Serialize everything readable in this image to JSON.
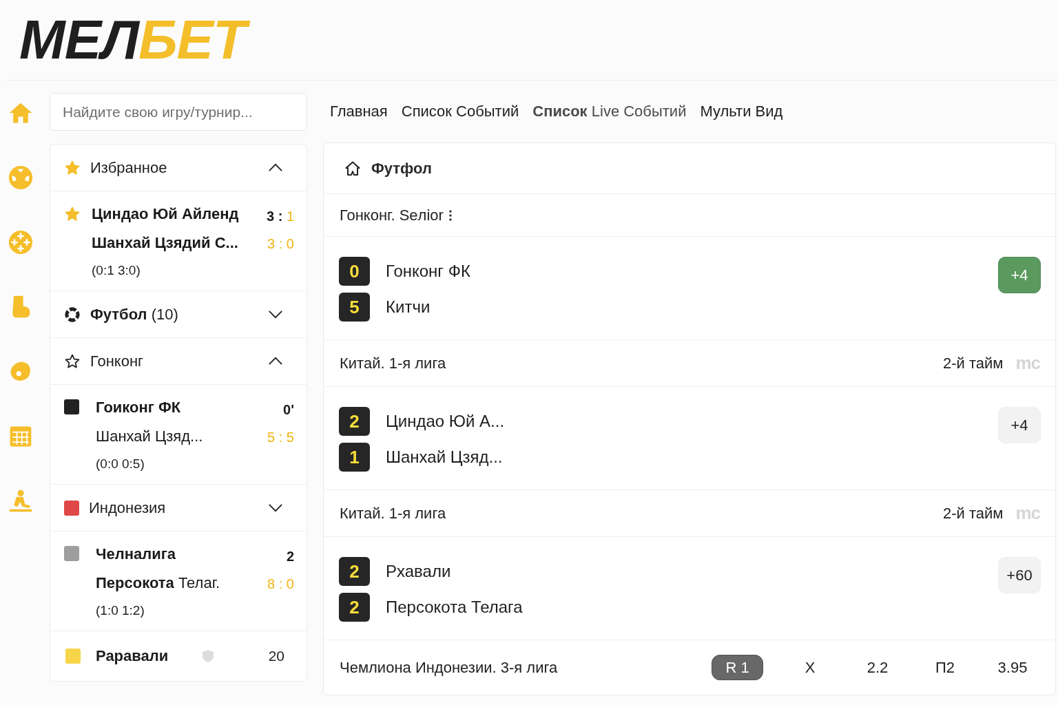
{
  "logo": {
    "dark_part": "МЕЛ",
    "accent_part": "БЕТ"
  },
  "search": {
    "placeholder": "Найдите свою игру/турнир..."
  },
  "sidebar": {
    "items": [
      {
        "kind": "section",
        "label": "Избранное",
        "favorite": true,
        "expanded": true
      },
      {
        "kind": "match",
        "favorite": true,
        "teams": [
          {
            "name": "Циндао Юй Айленд",
            "bold": true
          },
          {
            "name": "Шанхай Цзядий С...",
            "bold": true
          }
        ],
        "detail": "(0:1 3:0)",
        "score_lines": [
          [
            {
              "text": "3 :",
              "accent": false
            },
            {
              "text": "1",
              "accent": true
            }
          ],
          [
            {
              "text": "3 : 0",
              "accent": true
            }
          ]
        ]
      },
      {
        "kind": "sport",
        "label": "**Футбол** (10)",
        "expanded": false
      },
      {
        "kind": "section",
        "label": "Гонконг",
        "favorite": false,
        "expanded": true
      },
      {
        "kind": "match",
        "color": "#222222",
        "teams": [
          {
            "name": "Гоиконг ФК",
            "bold": true
          },
          {
            "name": "Шанхай Цзяд...",
            "bold": false
          }
        ],
        "detail": "(0:0 0:5)",
        "score_lines": [
          [
            {
              "text": "0'",
              "accent": false
            }
          ],
          [
            {
              "text": "5 : 5",
              "accent": true
            }
          ]
        ]
      },
      {
        "kind": "country",
        "label": "Индонезия",
        "color": "#e04848",
        "expanded": false
      },
      {
        "kind": "match",
        "color": "#9e9e9e",
        "teams": [
          {
            "name": "Челналига",
            "bold": true
          },
          {
            "name": "**Персокота** Телаг.",
            "bold": false
          }
        ],
        "detail": "(1:0 1:2)",
        "score_lines": [
          [
            {
              "text": "2",
              "accent": false
            }
          ],
          [
            {
              "text": "8 : 0",
              "accent": true
            }
          ]
        ]
      },
      {
        "kind": "compact",
        "color": "#f7d54a",
        "name": "Раравали",
        "score": "20"
      }
    ]
  },
  "nav": {
    "tabs": [
      {
        "label": "Главная",
        "selected": false
      },
      {
        "label": "Список Событий",
        "selected": false
      },
      {
        "label": "**Список** Live Событий",
        "selected": true
      },
      {
        "label": "Мульти Вид",
        "selected": false
      }
    ]
  },
  "events": {
    "title": "Футфол",
    "rows": [
      {
        "kind": "league",
        "label": "Гонконг. Seлior",
        "menu": true
      },
      {
        "kind": "match",
        "teams": [
          {
            "score": "0",
            "name": "Гонконг ФК"
          },
          {
            "score": "5",
            "name": "Китчи"
          }
        ],
        "more": {
          "label": "+4",
          "selected": true
        }
      },
      {
        "kind": "league",
        "label": "Китай. 1-я лига",
        "period": "2-й тайм",
        "badge": "mc"
      },
      {
        "kind": "match",
        "teams": [
          {
            "score": "2",
            "name": "Циндао Юй А..."
          },
          {
            "score": "1",
            "name": "Шанхай Цзяд..."
          }
        ],
        "more": {
          "label": "+4",
          "selected": false
        }
      },
      {
        "kind": "league",
        "label": "Китай. 1-я лига",
        "period": "2-й тайм",
        "badge": "mc"
      },
      {
        "kind": "match",
        "teams": [
          {
            "score": "2",
            "name": "Рхавали"
          },
          {
            "score": "2",
            "name": "Персокота Телага"
          }
        ],
        "more": {
          "label": "+60",
          "selected": false
        }
      },
      {
        "kind": "league",
        "label": "Чемлиона Индонезии. 3-я лига",
        "odds": [
          {
            "text": "R 1",
            "selected": true
          },
          {
            "text": "X",
            "selected": false
          },
          {
            "text": "2.2",
            "selected": false
          },
          {
            "text": "П2",
            "selected": false
          },
          {
            "text": "3.95",
            "selected": false
          }
        ]
      }
    ]
  }
}
